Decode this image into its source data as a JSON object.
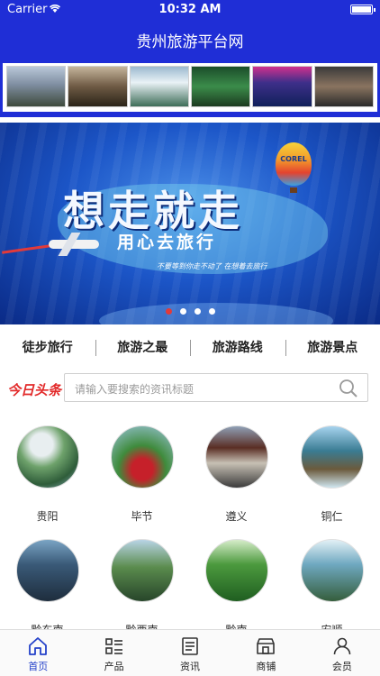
{
  "status_bar": {
    "carrier": "Carrier",
    "time": "10:32 AM"
  },
  "nav": {
    "title": "贵州旅游平台网"
  },
  "banner": {
    "title": "想走就走",
    "subtitle": "用心去旅行",
    "slogan": "不要等到你走不动了 在想着去旅行",
    "balloon_text": "COREL",
    "pages": 4,
    "active_page": 1
  },
  "categories": [
    "徒步旅行",
    "旅游之最",
    "旅游路线",
    "旅游景点"
  ],
  "search": {
    "logo": "今日头条",
    "placeholder": "请输入要搜索的资讯标题"
  },
  "regions": [
    "贵阳",
    "毕节",
    "遵义",
    "铜仁",
    "黔东南",
    "黔西南",
    "黔南",
    "安顺"
  ],
  "tabbar": {
    "items": [
      "首页",
      "产品",
      "资讯",
      "商铺",
      "会员"
    ],
    "active": "首页",
    "active_color": "#2441c9"
  },
  "colors": {
    "brand": "#1f2ed6",
    "logo_red": "#e22a2a"
  }
}
